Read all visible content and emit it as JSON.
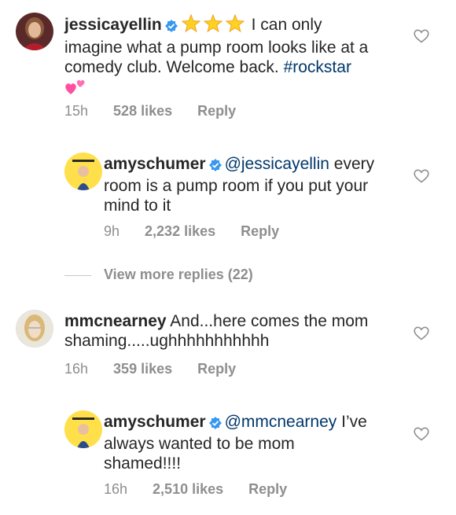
{
  "comments": [
    {
      "username": "jessicayellin",
      "verified": true,
      "line1_after": "I can only",
      "line2": "imagine what a pump room looks like at a",
      "line3_pre": "comedy club. Welcome back.",
      "hashtag": "#rockstar",
      "time": "15h",
      "likes": "528 likes",
      "reply": "Reply"
    },
    {
      "username": "amyschumer",
      "verified": true,
      "mention": "@jessicayellin",
      "line1_after": "every",
      "line2": "room is a pump room if you put your",
      "line3": "mind to it",
      "time": "9h",
      "likes": "2,232 likes",
      "reply": "Reply"
    },
    {
      "username": "mmcnearney",
      "verified": false,
      "line1_after": "And...here comes the mom",
      "line2": "shaming.....ughhhhhhhhhhh",
      "time": "16h",
      "likes": "359 likes",
      "reply": "Reply"
    },
    {
      "username": "amyschumer",
      "verified": true,
      "mention": "@mmcnearney",
      "line1_after": "I’ve",
      "line2": "always wanted to be mom",
      "line3": "shamed!!!!",
      "time": "16h",
      "likes": "2,510 likes",
      "reply": "Reply"
    }
  ],
  "view_more_replies": "View more replies (22)",
  "colors": {
    "text": "#262626",
    "meta": "#8e8e8e",
    "link": "#00376b",
    "verified": "#3897f0"
  },
  "icons": [
    "verified-badge-icon",
    "star-emoji-icon",
    "two-hearts-emoji-icon",
    "heart-outline-icon"
  ]
}
